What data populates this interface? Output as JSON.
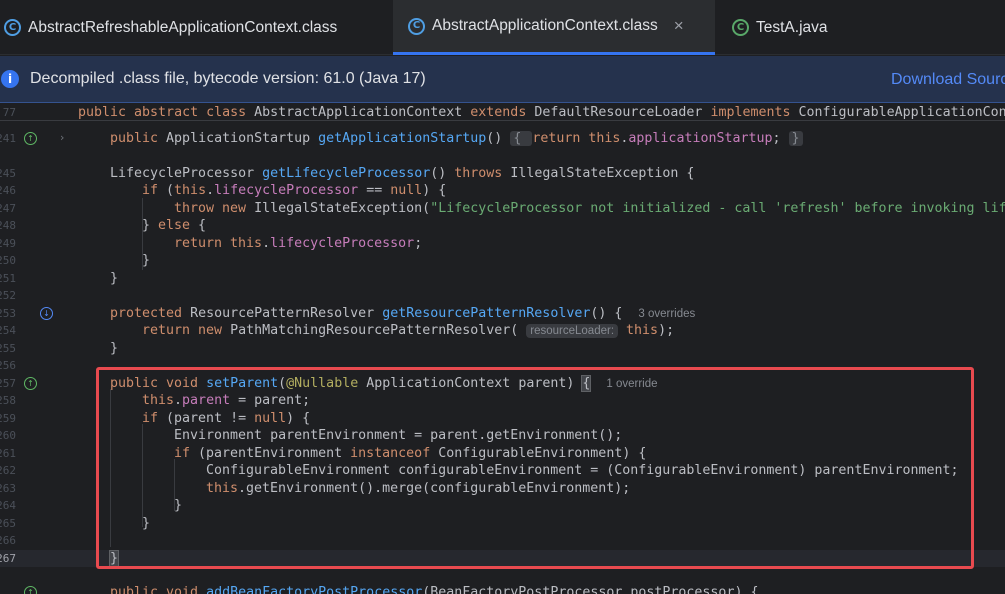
{
  "tabs": [
    {
      "label": "AbstractRefreshableApplicationContext.class",
      "icon": "class-file-icon",
      "type": "class",
      "active": false
    },
    {
      "label": "AbstractApplicationContext.class",
      "icon": "class-file-icon",
      "type": "class",
      "active": true,
      "close": "×"
    },
    {
      "label": "TestA.java",
      "icon": "java-file-icon",
      "type": "java",
      "active": false
    }
  ],
  "banner": {
    "message": "Decompiled .class file, bytecode version: 61.0 (Java 17)",
    "action": "Download Sources"
  },
  "editor": {
    "line_numbers": [
      "77",
      "241",
      "",
      "245",
      "246",
      "247",
      "248",
      "249",
      "250",
      "251",
      "252",
      "253",
      "254",
      "255",
      "256",
      "257",
      "258",
      "259",
      "260",
      "261",
      "262",
      "263",
      "264",
      "265",
      "266",
      "267",
      ""
    ],
    "inlay_hints": {
      "resource_loader": "resourceLoader:",
      "overrides_3": "3 overrides",
      "override_1": "1 override"
    }
  },
  "colors": {
    "accent": "#3574f0",
    "highlight_box": "#e84a4f",
    "keyword": "#cf8e6d",
    "function": "#56a8f5",
    "field": "#c77dbb",
    "string": "#6aab73"
  }
}
